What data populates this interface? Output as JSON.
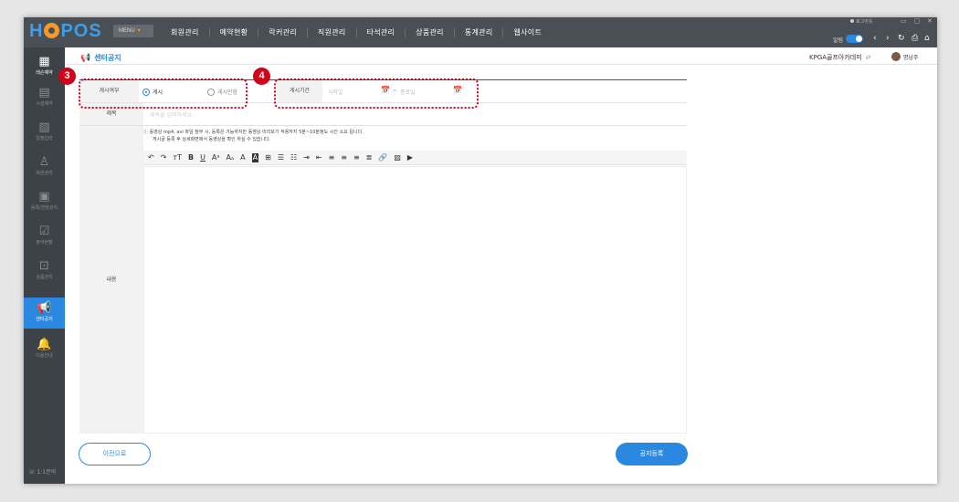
{
  "brand": {
    "logo": "HOPOS",
    "menu_label": "MENU"
  },
  "nav": [
    "회원관리",
    "예약현황",
    "락커관리",
    "직원관리",
    "타석관리",
    "상품관리",
    "통계관리",
    "웹사이트"
  ],
  "topbar": {
    "logout": "로그아웃",
    "alarm": "알림"
  },
  "sidebar": {
    "items": [
      {
        "label": "레슨예약",
        "icon": "calendar-icon"
      },
      {
        "label": "시설예약",
        "icon": "facility-icon"
      },
      {
        "label": "일정입력",
        "icon": "schedule-icon"
      },
      {
        "label": "회원관리",
        "icon": "person-icon"
      },
      {
        "label": "등록/연장관리",
        "icon": "register-icon"
      },
      {
        "label": "출석현황",
        "icon": "attendance-icon"
      },
      {
        "label": "상품관리",
        "icon": "product-icon"
      },
      {
        "label": "센터공지",
        "icon": "megaphone-icon"
      },
      {
        "label": "이용안내",
        "icon": "bell-icon"
      }
    ],
    "footer": "1:1문의"
  },
  "header": {
    "title": "센터공지",
    "company": "KPGA골프아카데미",
    "user": "명남주"
  },
  "form": {
    "post_label": "게시여부",
    "post_option": "게시",
    "nopost_option": "게시안함",
    "period_label": "게시기간",
    "start_placeholder": "시작일",
    "tilde": "~",
    "end_placeholder": "종료일",
    "title_label": "제목",
    "title_placeholder": "제목을 입력하세요.",
    "content_label": "내용",
    "notice_line1": "ⓘ 동영상 mp4, avi 파일 첨부 시, 등록은 가능하지만 동영상 미리보기 적용까지 5분~10분정도 시간 소요 됩니다.",
    "notice_line2": "게시글 등록 후 상세화면에서 동영상을 확인 하실 수 있습니다."
  },
  "annotations": {
    "badge_period_post": "3",
    "badge_period_date": "4"
  },
  "buttons": {
    "prev": "이전으로",
    "submit": "공지등록"
  },
  "colors": {
    "accent": "#2b88e0",
    "highlight": "#d0021b",
    "topbar": "#4a4f55",
    "sidebar": "#3d4248"
  }
}
